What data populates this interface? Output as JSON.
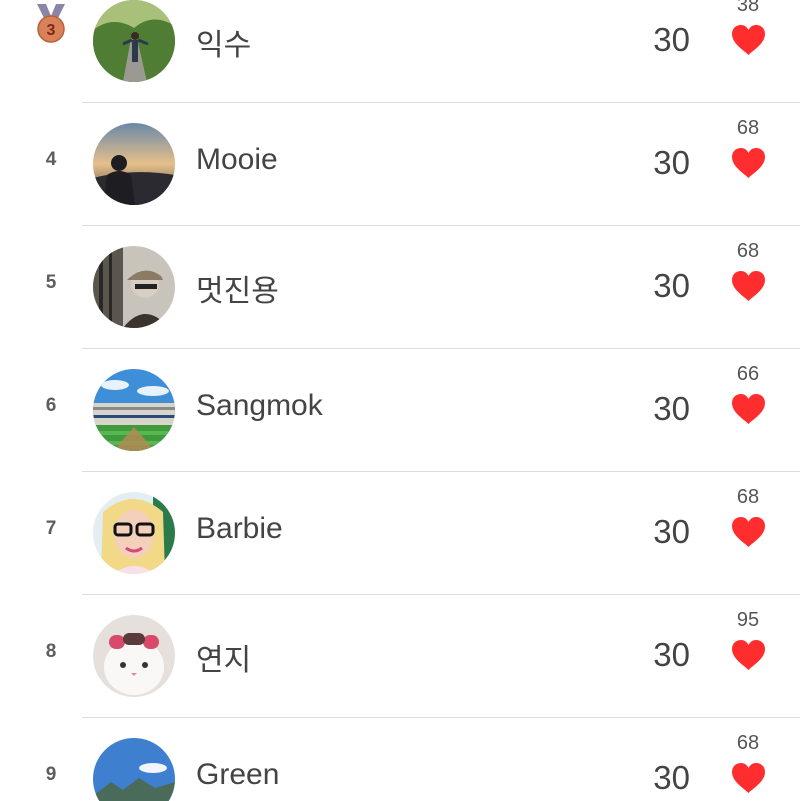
{
  "ranking": {
    "rows": [
      {
        "rank": "3",
        "name": "익수",
        "score": "30",
        "likes": "38",
        "medal": "bronze",
        "avatar": "person-on-road"
      },
      {
        "rank": "4",
        "name": "Mooie",
        "score": "30",
        "likes": "68",
        "avatar": "person-at-sunset"
      },
      {
        "rank": "5",
        "name": "멋진용",
        "score": "30",
        "likes": "68",
        "avatar": "man-in-cap"
      },
      {
        "rank": "6",
        "name": "Sangmok",
        "score": "30",
        "likes": "66",
        "avatar": "baseball-stadium"
      },
      {
        "rank": "7",
        "name": "Barbie",
        "score": "30",
        "likes": "68",
        "avatar": "doll-with-glasses"
      },
      {
        "rank": "8",
        "name": "연지",
        "score": "30",
        "likes": "95",
        "avatar": "white-cat"
      },
      {
        "rank": "9",
        "name": "Green",
        "score": "30",
        "likes": "68",
        "avatar": "mountain-landscape"
      }
    ]
  },
  "colors": {
    "heart": "#ff2d2d",
    "medal_bronze": "#d9825a",
    "medal_ribbon": "#8a85a6",
    "divider": "#dddddd"
  }
}
